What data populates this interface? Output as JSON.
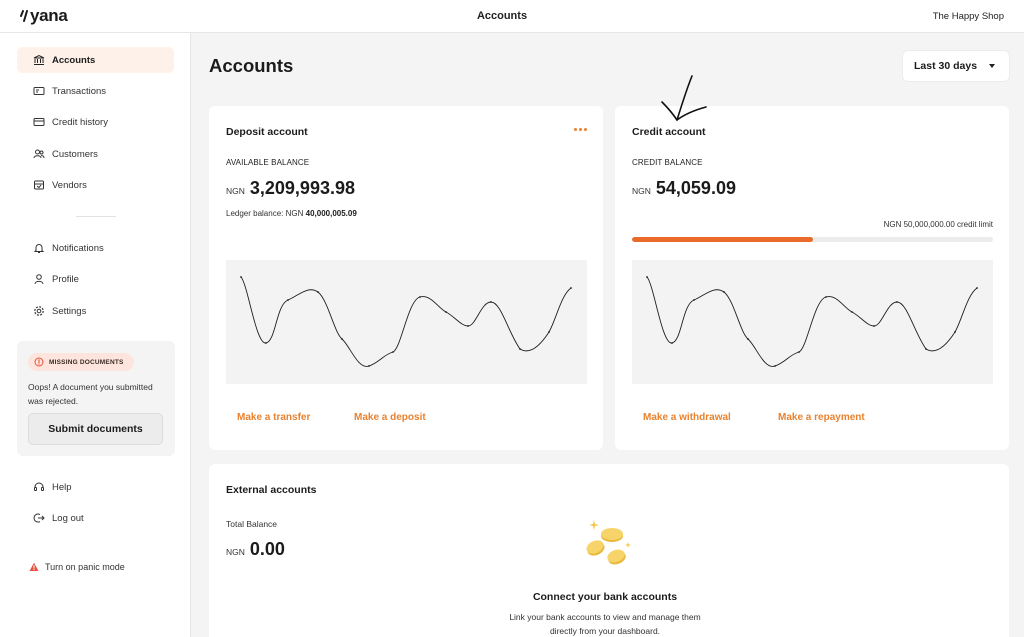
{
  "header": {
    "logo_text": "yana",
    "title": "Accounts",
    "shop_name": "The Happy Shop"
  },
  "sidebar": {
    "items": [
      {
        "label": "Accounts",
        "icon": "bank-icon",
        "active": true
      },
      {
        "label": "Transactions",
        "icon": "receipt-icon",
        "active": false
      },
      {
        "label": "Credit history",
        "icon": "credit-card-icon",
        "active": false
      },
      {
        "label": "Customers",
        "icon": "users-icon",
        "active": false
      },
      {
        "label": "Vendors",
        "icon": "store-icon",
        "active": false
      }
    ],
    "secondary_items": [
      {
        "label": "Notifications",
        "icon": "bell-icon"
      },
      {
        "label": "Profile",
        "icon": "user-icon"
      },
      {
        "label": "Settings",
        "icon": "gear-icon"
      }
    ],
    "missing": {
      "badge": "MISSING DOCUMENTS",
      "message": "Oops! A document you submitted was rejected.",
      "button": "Submit documents"
    },
    "bottom_items": [
      {
        "label": "Help",
        "icon": "headset-icon"
      },
      {
        "label": "Log out",
        "icon": "logout-icon"
      }
    ],
    "panic": "Turn on panic mode"
  },
  "main": {
    "title": "Accounts",
    "range": "Last 30 days"
  },
  "deposit": {
    "title": "Deposit account",
    "label": "AVAILABLE BALANCE",
    "currency": "NGN",
    "balance": "3,209,993.98",
    "ledger_prefix": "Ledger balance: NGN",
    "ledger_value": "40,000,005.09",
    "actions": [
      "Make a transfer",
      "Make a deposit"
    ]
  },
  "credit": {
    "title": "Credit account",
    "label": "CREDIT BALANCE",
    "currency": "NGN",
    "balance": "54,059.09",
    "limit_text": "NGN 50,000,000.00 credit limit",
    "usage_fraction": 0.5,
    "actions": [
      "Make a withdrawal",
      "Make a repayment"
    ]
  },
  "external": {
    "title": "External accounts",
    "total_label": "Total Balance",
    "currency": "NGN",
    "balance": "0.00",
    "connect_title": "Connect your bank accounts",
    "connect_text": "Link your bank accounts to view and manage them directly from your dashboard."
  },
  "colors": {
    "accent": "#e8822f",
    "progress": "#ea6a2a",
    "active_bg": "#fdf1e9",
    "badge_bg": "#fde5dd",
    "warning": "#e5533d"
  }
}
